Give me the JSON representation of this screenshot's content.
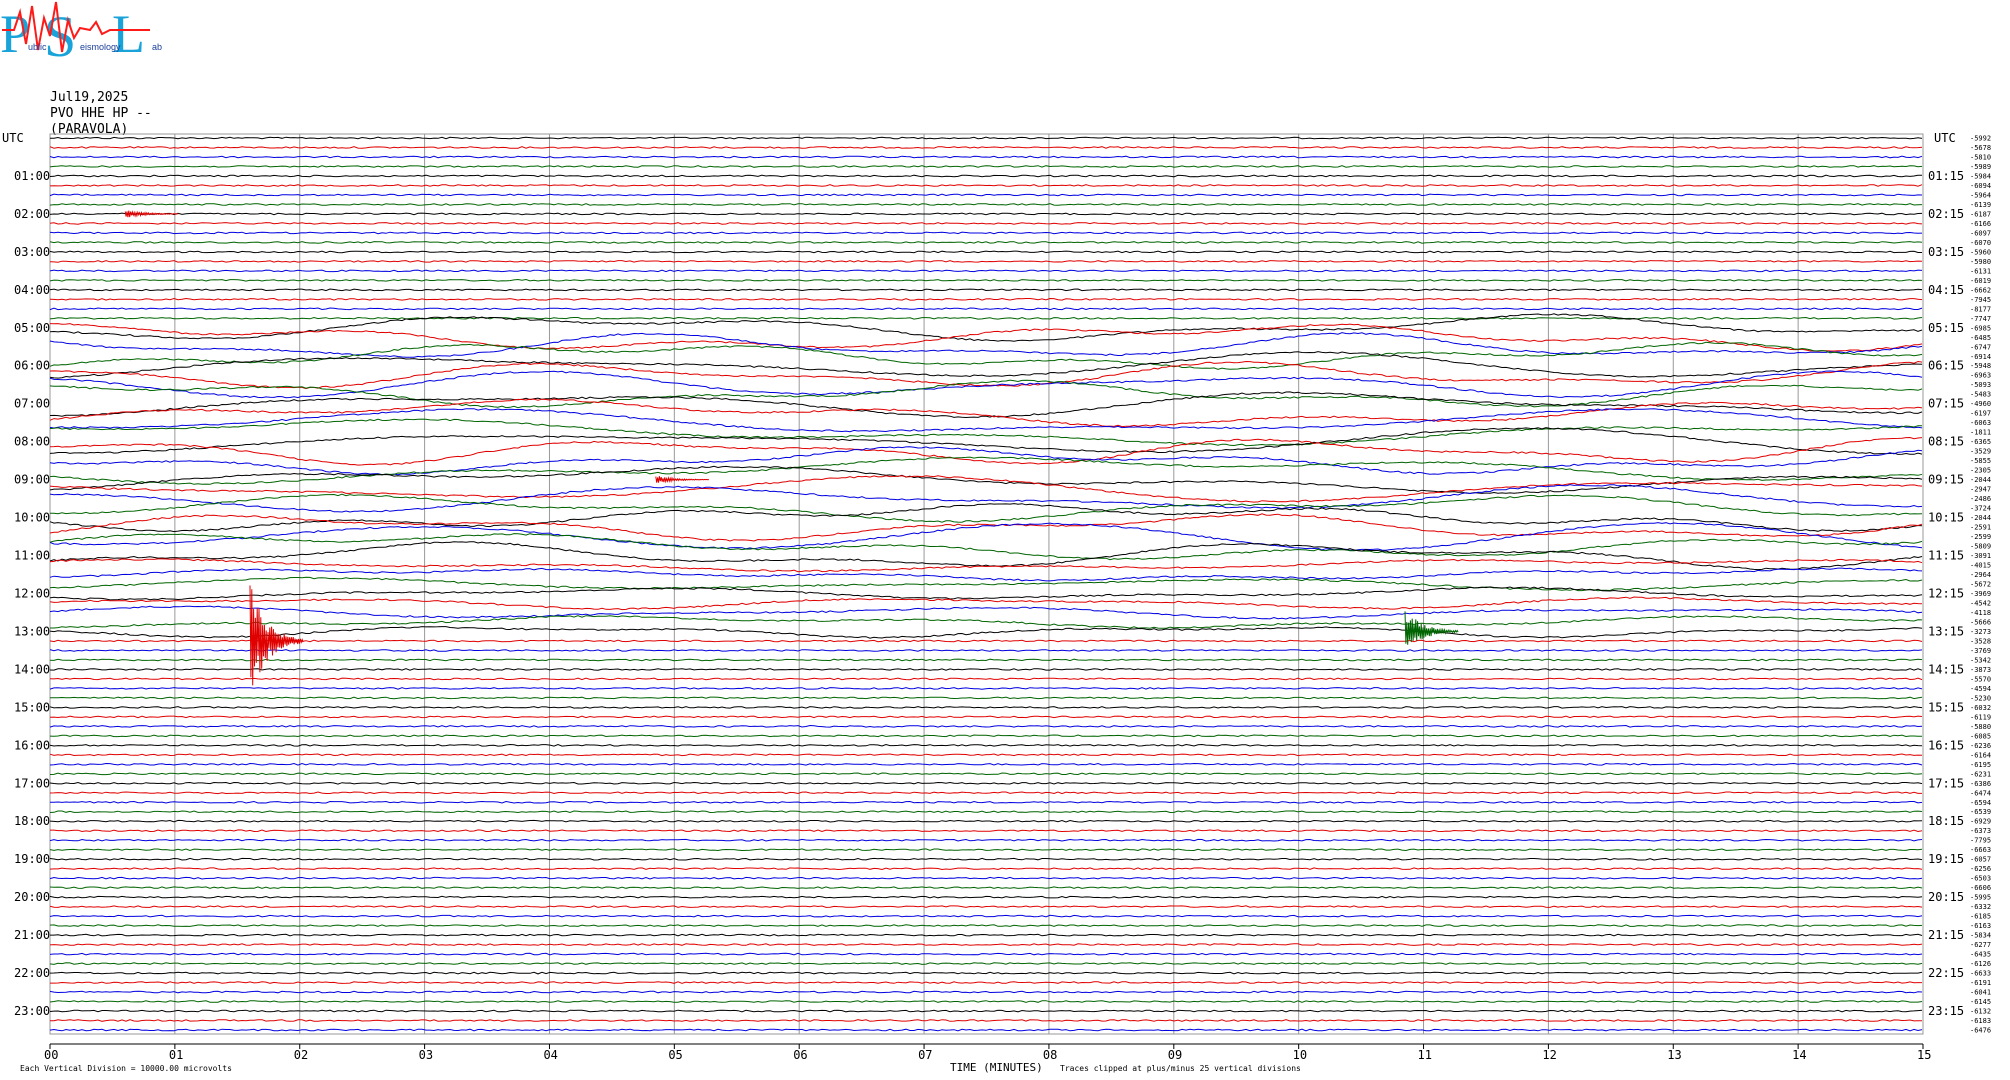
{
  "logo": {
    "letters": [
      "P",
      "S",
      "L"
    ],
    "small_words": [
      "ublic",
      "eismology",
      "ab"
    ]
  },
  "header": {
    "date": "Jul19,2025",
    "station": "PVO HHE HP --",
    "location": "(PARAVOLA)"
  },
  "footer": {
    "vertical_division": "Each Vertical Division = 10000.00 microvolts",
    "xlabel": "TIME (MINUTES)",
    "clip_note": "Traces clipped at plus/minus 25 vertical divisions"
  },
  "chart_data": {
    "type": "line",
    "title": "",
    "xlabel": "TIME (MINUTES)",
    "ylabel": "UTC",
    "xlim": [
      0,
      15
    ],
    "x_ticks": [
      "00",
      "01",
      "02",
      "03",
      "04",
      "05",
      "06",
      "07",
      "08",
      "09",
      "10",
      "11",
      "12",
      "13",
      "14",
      "15"
    ],
    "grid": true,
    "trace_colors": [
      "#000000",
      "#e00000",
      "#0000e0",
      "#006400"
    ],
    "left_labels": [
      "UTC",
      "01:00",
      "02:00",
      "03:00",
      "04:00",
      "05:00",
      "06:00",
      "07:00",
      "08:00",
      "09:00",
      "10:00",
      "11:00",
      "12:00",
      "13:00",
      "14:00",
      "15:00",
      "16:00",
      "17:00",
      "18:00",
      "19:00",
      "20:00",
      "21:00",
      "22:00",
      "23:00"
    ],
    "right_labels": [
      "UTC",
      "01:15",
      "02:15",
      "03:15",
      "04:15",
      "05:15",
      "06:15",
      "07:15",
      "08:15",
      "09:15",
      "10:15",
      "11:15",
      "12:15",
      "13:15",
      "14:15",
      "15:15",
      "16:15",
      "17:15",
      "18:15",
      "19:15",
      "20:15",
      "21:15",
      "22:15",
      "23:15"
    ],
    "trace_offsets": [
      "-5992",
      "-5678",
      "-5810",
      "-5989",
      "-5984",
      "-6094",
      "-5964",
      "-6139",
      "-6187",
      "-6166",
      "-6097",
      "-6070",
      "-5960",
      "-5980",
      "-6131",
      "-6019",
      "-6662",
      "-7945",
      "-8177",
      "-7747",
      "-6985",
      "-6485",
      "-6747",
      "-6914",
      "-5948",
      "-6963",
      "-5093",
      "-5483",
      "-4960",
      "-6197",
      "-6063",
      "-1811",
      "-6365",
      "-3529",
      "-5855",
      "-2305",
      "-2044",
      "-2947",
      "-2486",
      "-3724",
      "-2044",
      "-2591",
      "-2599",
      "-5809",
      "-3091",
      "-4015",
      "-2964",
      "-5672",
      "-3969",
      "-4542",
      "-4118",
      "-5666",
      "-3273",
      "-3528",
      "-3769",
      "-5342",
      "-3873",
      "-5570",
      "-4594",
      "-5230",
      "-6032",
      "-6119",
      "-5880",
      "-6085",
      "-6236",
      "-6164",
      "-6195",
      "-6231",
      "-6386",
      "-6474",
      "-6594",
      "-6539",
      "-6929",
      "-6373",
      "-7795",
      "-6663",
      "-6057",
      "-6256",
      "-6503",
      "-6606",
      "-5995",
      "-6332",
      "-6185",
      "-6163",
      "-5834",
      "-6277",
      "-6435",
      "-6126",
      "-6633",
      "-6191",
      "-6041",
      "-6145",
      "-6132",
      "-6183",
      "-6476"
    ],
    "events": [
      {
        "trace": 53,
        "t_min": 1.65,
        "amp_div": 25,
        "color": "#e00000"
      },
      {
        "trace": 52,
        "t_min": 10.9,
        "amp_div": 10,
        "color": "#006400"
      },
      {
        "trace": 8,
        "t_min": 0.65,
        "amp_div": 2,
        "color": "#e00000"
      },
      {
        "trace": 36,
        "t_min": 4.9,
        "amp_div": 2,
        "color": "#e00000"
      }
    ]
  }
}
